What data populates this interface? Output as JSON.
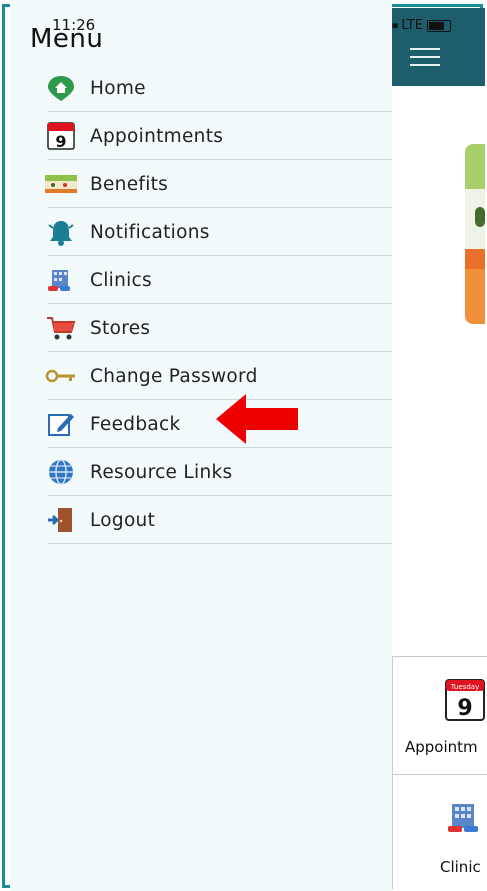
{
  "status_bar": {
    "time": "11:26",
    "network": "LTE"
  },
  "drawer": {
    "title": "Menu",
    "items": [
      {
        "label": "Home",
        "icon": "home-location-icon"
      },
      {
        "label": "Appointments",
        "icon": "calendar-icon"
      },
      {
        "label": "Benefits",
        "icon": "benefits-icon"
      },
      {
        "label": "Notifications",
        "icon": "bell-icon"
      },
      {
        "label": "Clinics",
        "icon": "clinic-building-icon"
      },
      {
        "label": "Stores",
        "icon": "shopping-cart-icon"
      },
      {
        "label": "Change Password",
        "icon": "key-icon"
      },
      {
        "label": "Feedback",
        "icon": "edit-icon"
      },
      {
        "label": "Resource Links",
        "icon": "globe-icon"
      },
      {
        "label": "Logout",
        "icon": "logout-door-icon"
      }
    ]
  },
  "background_app": {
    "tiles": [
      {
        "label": "Appointm",
        "icon": "calendar-icon",
        "calendar_day": "9",
        "calendar_weekday": "Tuesday"
      },
      {
        "label": "Clinic",
        "icon": "clinic-building-icon"
      }
    ]
  },
  "annotation": {
    "icon": "red-arrow-icon",
    "points_to": "Feedback"
  },
  "colors": {
    "app_bar": "#1e5d6b",
    "frame_border": "#1b8c9a",
    "drawer_background": "#f3fafb",
    "annotation_arrow": "#ee0000"
  }
}
